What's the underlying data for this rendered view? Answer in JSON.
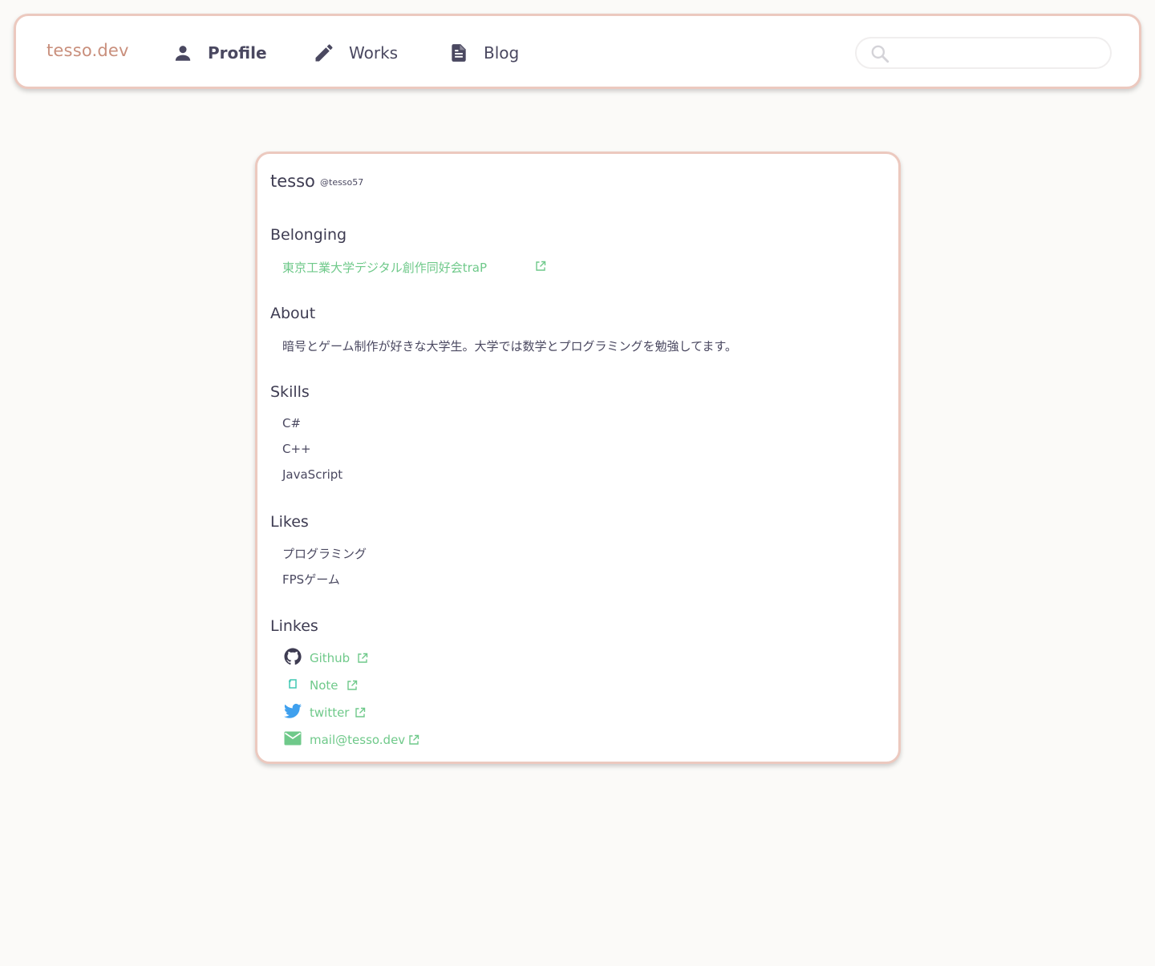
{
  "nav": {
    "brand": "tesso.dev",
    "items": [
      {
        "label": "Profile",
        "icon": "person-icon"
      },
      {
        "label": "Works",
        "icon": "pencil-icon"
      },
      {
        "label": "Blog",
        "icon": "document-icon"
      }
    ],
    "search": {
      "placeholder": "",
      "value": ""
    }
  },
  "profile": {
    "name": "tesso",
    "handle": "@tesso57",
    "sections": {
      "belonging": "Belonging",
      "about": "About",
      "skills": "Skills",
      "likes": "Likes",
      "links": "Linkes"
    },
    "belonging": [
      "東京工業大学デジタル創作同好会traP"
    ],
    "about": "暗号とゲーム制作が好きな大学生。大学では数学とプログラミングを勉強してます。",
    "skills": [
      "C#",
      "C++",
      "JavaScript"
    ],
    "likes": [
      "プログラミング",
      "FPSゲーム"
    ],
    "links": [
      {
        "label": "Github",
        "icon": "github-icon"
      },
      {
        "label": "Note",
        "icon": "note-icon"
      },
      {
        "label": "twitter",
        "icon": "twitter-icon"
      },
      {
        "label": "mail@tesso.dev",
        "icon": "mail-icon"
      }
    ]
  },
  "colors": {
    "brand": "#c98f7c",
    "border": "#ecc9bf",
    "link": "#6fc98a",
    "text": "#4a4860",
    "background": "#fbfaf8"
  }
}
